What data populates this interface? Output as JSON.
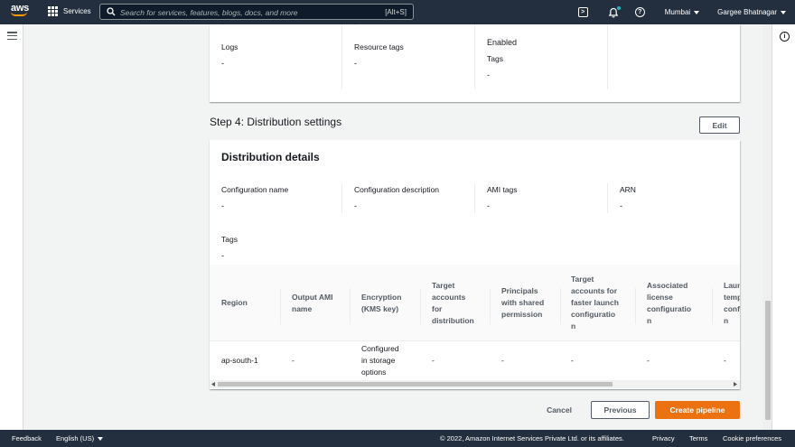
{
  "topnav": {
    "logo_text": "aws",
    "services_label": "Services",
    "search_placeholder": "Search for services, features, blogs, docs, and more",
    "search_shortcut": "[Alt+S]",
    "region": "Mumbai",
    "user": "Gargee Bhatnagar"
  },
  "upper_card": {
    "top_dash": "-",
    "top_dash2": "-",
    "logs_label": "Logs",
    "logs_value": "-",
    "resource_tags_label": "Resource tags",
    "resource_tags_value": "-",
    "enabled_value": "Enabled",
    "tags_label": "Tags",
    "tags_value": "-"
  },
  "step4": {
    "title": "Step 4: Distribution settings",
    "edit_label": "Edit"
  },
  "distribution": {
    "heading": "Distribution details",
    "fields": [
      {
        "label": "Configuration name",
        "value": "-"
      },
      {
        "label": "Configuration description",
        "value": "-"
      },
      {
        "label": "AMI tags",
        "value": "-"
      },
      {
        "label": "ARN",
        "value": "-"
      }
    ],
    "tags_label": "Tags",
    "tags_value": "-",
    "table": {
      "headers": [
        "Region",
        "Output AMI name",
        "Encryption (KMS key)",
        "Target accounts for distribution",
        "Principals with shared permission",
        "Target accounts for faster launch configuration",
        "Associated license configuration",
        "Launch template configuration"
      ],
      "header_lines": [
        [
          "Region"
        ],
        [
          "Output AMI",
          "name"
        ],
        [
          "Encryption",
          "(KMS key)"
        ],
        [
          "Target",
          "accounts",
          "for",
          "distribution"
        ],
        [
          "Principals",
          "with shared",
          "permission"
        ],
        [
          "Target",
          "accounts for",
          "faster launch",
          "configuratio",
          "n"
        ],
        [
          "Associated",
          "license",
          "configuratio",
          "n"
        ],
        [
          "Laun",
          "temp",
          "conf",
          "n"
        ]
      ],
      "row": {
        "region": "ap-south-1",
        "output_ami": "-",
        "encryption_lines": [
          "Configured",
          "in storage",
          "options"
        ],
        "target_accounts": "-",
        "principals": "-",
        "faster_launch": "-",
        "license": "-",
        "launch_template": "-"
      }
    }
  },
  "actions": {
    "cancel": "Cancel",
    "previous": "Previous",
    "create": "Create pipeline"
  },
  "footer": {
    "feedback": "Feedback",
    "language": "English (US)",
    "copyright": "© 2022, Amazon Internet Services Private Ltd. or its affiliates.",
    "privacy": "Privacy",
    "terms": "Terms",
    "cookie": "Cookie preferences"
  }
}
